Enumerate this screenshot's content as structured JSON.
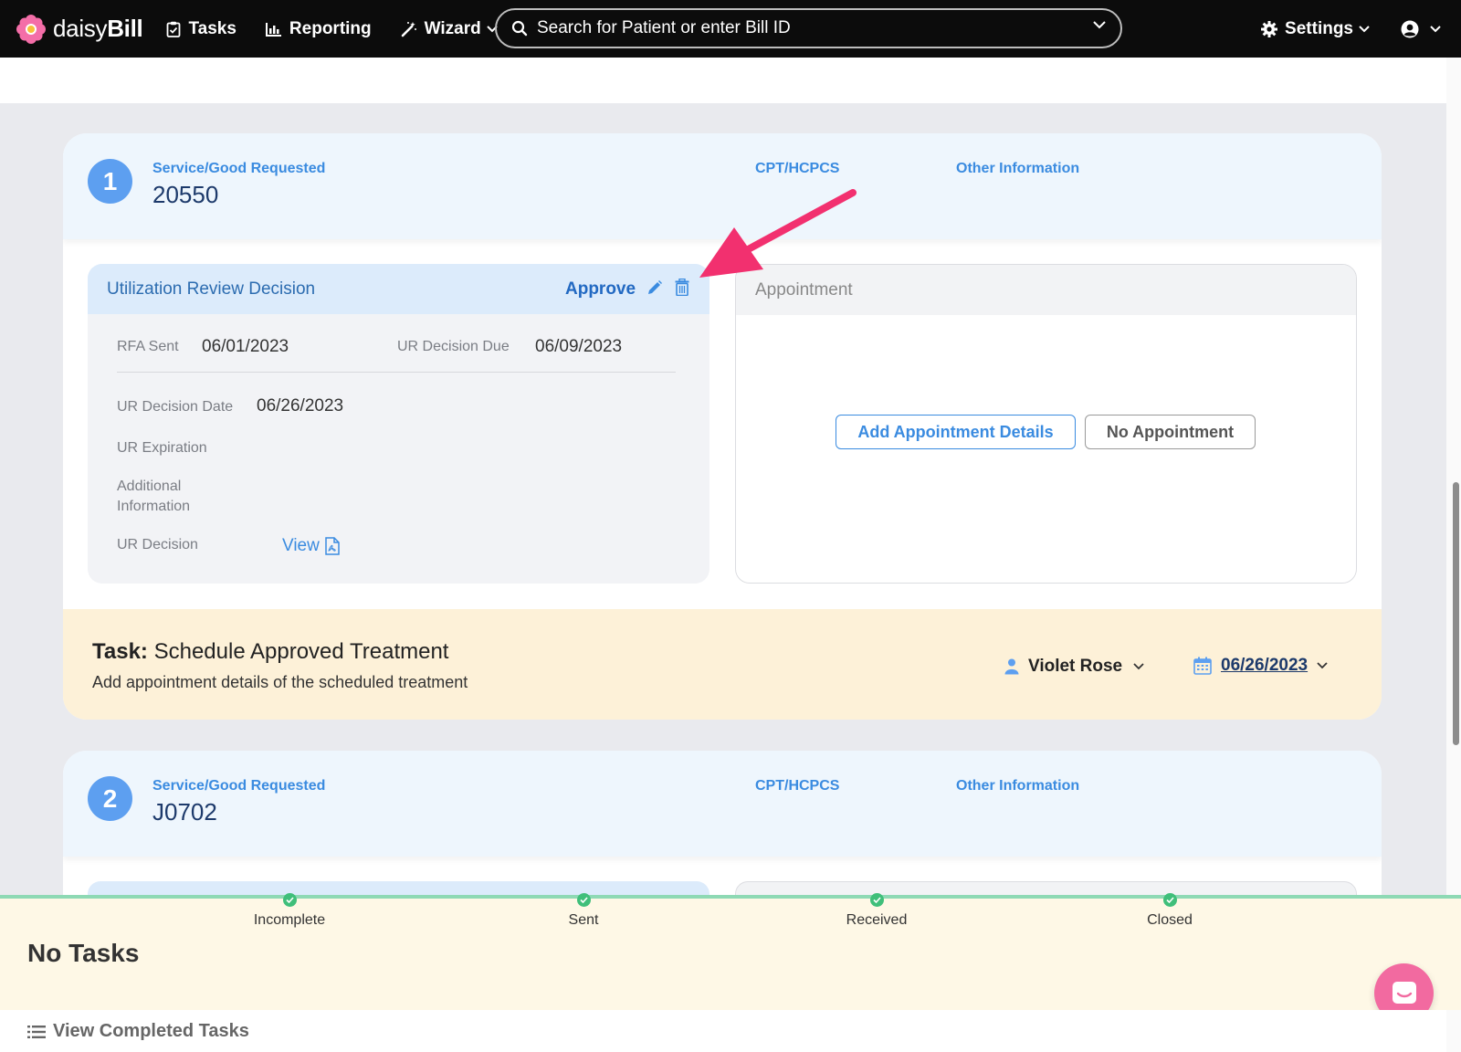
{
  "nav": {
    "logo_text_light": "daisy",
    "logo_text_bold": "Bill",
    "tasks": "Tasks",
    "reporting": "Reporting",
    "wizard": "Wizard",
    "search_placeholder": "Search for Patient or enter Bill ID",
    "settings": "Settings"
  },
  "service1": {
    "number": "1",
    "service_label": "Service/Good Requested",
    "service_value": "20550",
    "cpt_label": "CPT/HCPCS",
    "other_label": "Other Information"
  },
  "ur": {
    "title": "Utilization Review Decision",
    "decision": "Approve",
    "rfa_sent_label": "RFA Sent",
    "rfa_sent_value": "06/01/2023",
    "due_label": "UR Decision Due",
    "due_value": "06/09/2023",
    "decision_date_label": "UR Decision Date",
    "decision_date_value": "06/26/2023",
    "expiration_label": "UR Expiration",
    "additional_label_line1": "Additional",
    "additional_label_line2": "Information",
    "ur_decision_label": "UR Decision",
    "view_link": "View"
  },
  "appointment": {
    "title": "Appointment",
    "add_button": "Add Appointment Details",
    "no_button": "No Appointment"
  },
  "task": {
    "prefix": "Task:",
    "title": "Schedule Approved Treatment",
    "description": "Add appointment details of the scheduled treatment",
    "assignee": "Violet Rose",
    "due_date": "06/26/2023"
  },
  "service2": {
    "number": "2",
    "service_label": "Service/Good Requested",
    "service_value": "J0702",
    "cpt_label": "CPT/HCPCS",
    "other_label": "Other Information"
  },
  "tracker": {
    "steps": [
      "Incomplete",
      "Sent",
      "Received",
      "Closed"
    ],
    "no_tasks": "No Tasks",
    "view_completed": "View Completed Tasks"
  },
  "colors": {
    "accent_blue": "#3a8be0",
    "badge_blue": "#5d9ff0",
    "task_bg": "#fdf1d8",
    "arrow_pink": "#f2306f",
    "chat_pink": "#f26aa0"
  }
}
